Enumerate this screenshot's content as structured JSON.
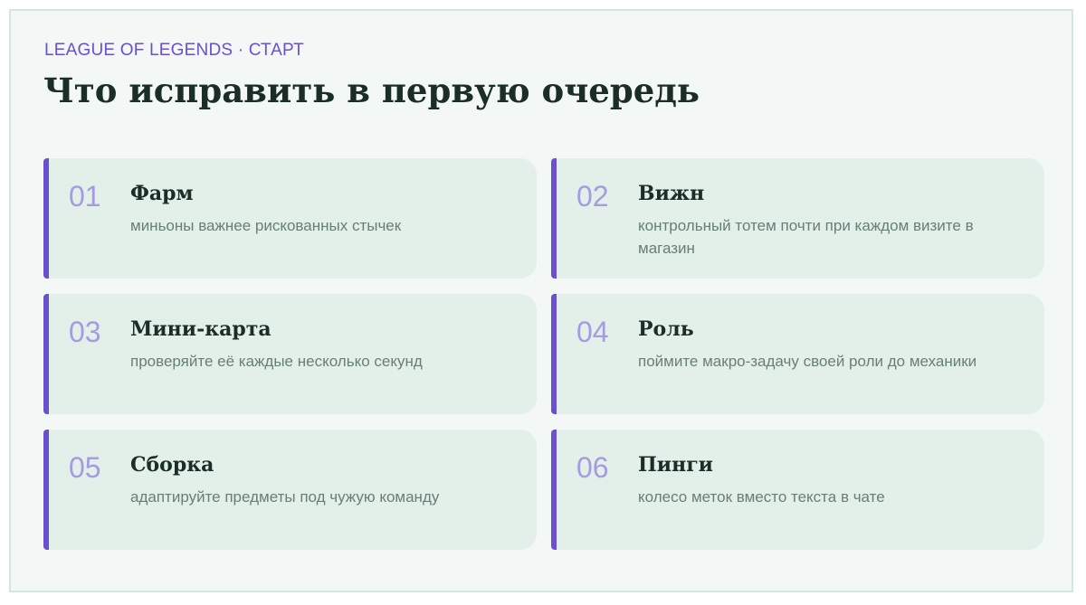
{
  "header": {
    "kicker": "LEAGUE OF LEGENDS · СТАРТ",
    "title": "Что исправить в первую очередь"
  },
  "cards": [
    {
      "num": "01",
      "title": "Фарм",
      "text": "миньоны важнее рискованных стычек"
    },
    {
      "num": "02",
      "title": "Вижн",
      "text": "контрольный тотем почти при каждом визите в магазин"
    },
    {
      "num": "03",
      "title": "Мини-карта",
      "text": "проверяйте её каждые несколько секунд"
    },
    {
      "num": "04",
      "title": "Роль",
      "text": "поймите макро-задачу своей роли до механики"
    },
    {
      "num": "05",
      "title": "Сборка",
      "text": "адаптируйте предметы под чужую команду"
    },
    {
      "num": "06",
      "title": "Пинги",
      "text": "колесо меток вместо текста в чате"
    }
  ],
  "colors": {
    "accent": "#6a4fcf",
    "number": "#a59be0",
    "card_bg": "#e3f0ea",
    "page_bg": "#f3f8f6",
    "heading": "#1a2d27",
    "muted_text": "#687e76"
  }
}
